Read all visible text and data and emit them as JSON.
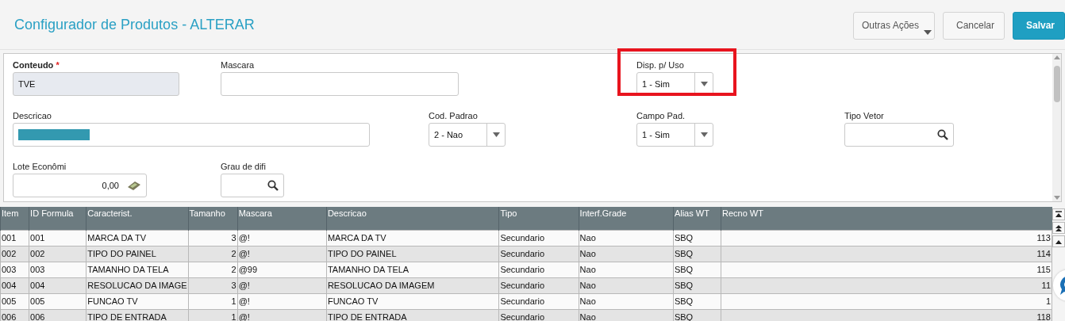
{
  "header": {
    "title": "Configurador de Produtos - ALTERAR",
    "buttons": [
      {
        "label": "Outras Ações",
        "kind": "menu"
      },
      {
        "label": "Cancelar",
        "kind": "plain"
      },
      {
        "label": "Salvar",
        "kind": "primary"
      }
    ]
  },
  "form": {
    "fields": [
      {
        "label": "Conteudo",
        "required": true,
        "required_mark": "*",
        "kind": "text",
        "value": "TVE",
        "readonly": true,
        "highlighted": false
      },
      {
        "label": "Mascara",
        "required": false,
        "kind": "text",
        "readonly": false,
        "highlighted": false
      },
      {
        "label": "Disp. p/ Uso",
        "required": false,
        "kind": "select",
        "value": "1 - Sim",
        "readonly": false,
        "highlighted": true
      },
      {
        "label": "Descricao",
        "required": false,
        "kind": "text",
        "readonly": false,
        "redacted": true,
        "highlighted": false
      },
      {
        "label": "Cod. Padrao",
        "required": false,
        "kind": "select",
        "value": "2 - Nao",
        "readonly": false,
        "highlighted": false
      },
      {
        "label": "Campo Pad.",
        "required": false,
        "kind": "select",
        "value": "1 - Sim",
        "readonly": false,
        "highlighted": false
      },
      {
        "label": "Tipo Vetor",
        "required": false,
        "kind": "lookup",
        "readonly": false,
        "highlighted": false
      },
      {
        "label": "Lote Econômi",
        "required": false,
        "kind": "number",
        "value": "0,00",
        "readonly": false,
        "highlighted": false
      },
      {
        "label": "Grau de difi",
        "required": false,
        "kind": "lookup",
        "readonly": false,
        "highlighted": false
      }
    ]
  },
  "table": {
    "columns": [
      "Item",
      "ID Formula",
      "Caracterist.",
      "Tamanho",
      "Mascara",
      "Descricao",
      "Tipo",
      "Interf.Grade",
      "Alias WT",
      "Recno WT"
    ],
    "rows": [
      [
        "001",
        "001",
        "MARCA DA TV",
        "3",
        "@!",
        "MARCA DA TV",
        "Secundario",
        "Nao",
        "SBQ",
        "113"
      ],
      [
        "002",
        "002",
        "TIPO DO PAINEL",
        "2",
        "@!",
        "TIPO DO PAINEL",
        "Secundario",
        "Nao",
        "SBQ",
        "114"
      ],
      [
        "003",
        "003",
        "TAMANHO DA TELA",
        "2",
        "@99",
        "TAMANHO DA TELA",
        "Secundario",
        "Nao",
        "SBQ",
        "115"
      ],
      [
        "004",
        "004",
        "RESOLUCAO DA IMAGE",
        "3",
        "@!",
        "RESOLUCAO DA IMAGEM",
        "Secundario",
        "Nao",
        "SBQ",
        "11"
      ],
      [
        "005",
        "005",
        "FUNCAO TV",
        "1",
        "@!",
        "FUNCAO TV",
        "Secundario",
        "Nao",
        "SBQ",
        "1"
      ],
      [
        "006",
        "006",
        "TIPO DE ENTRADA",
        "1",
        "@!",
        "TIPO DE ENTRADA",
        "Secundario",
        "Nao",
        "SBQ",
        "118"
      ]
    ]
  }
}
